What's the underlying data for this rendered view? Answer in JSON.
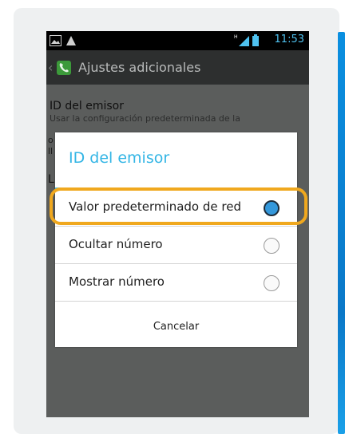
{
  "status_bar": {
    "time": "11:53",
    "icons": [
      "image-icon",
      "warning-icon",
      "signal-icon",
      "battery-icon"
    ]
  },
  "action_bar": {
    "title": "Ajustes adicionales",
    "back_glyph": "‹",
    "app_icon": "phone-icon"
  },
  "setting": {
    "title": "ID del emisor",
    "subtitle": "Usar la configuración predeterminada de la",
    "subtitle_continued_1": "o",
    "subtitle_continued_2": "ll",
    "next_item_initial": "L"
  },
  "dialog": {
    "title": "ID del emisor",
    "options": [
      {
        "label": "Valor predeterminado de red",
        "selected": true
      },
      {
        "label": "Ocultar número",
        "selected": false
      },
      {
        "label": "Mostrar número",
        "selected": false
      }
    ],
    "cancel_label": "Cancelar"
  },
  "colors": {
    "accent": "#33b5e5",
    "highlight": "#f0a81e",
    "card_accent": "#0a8fe0"
  }
}
